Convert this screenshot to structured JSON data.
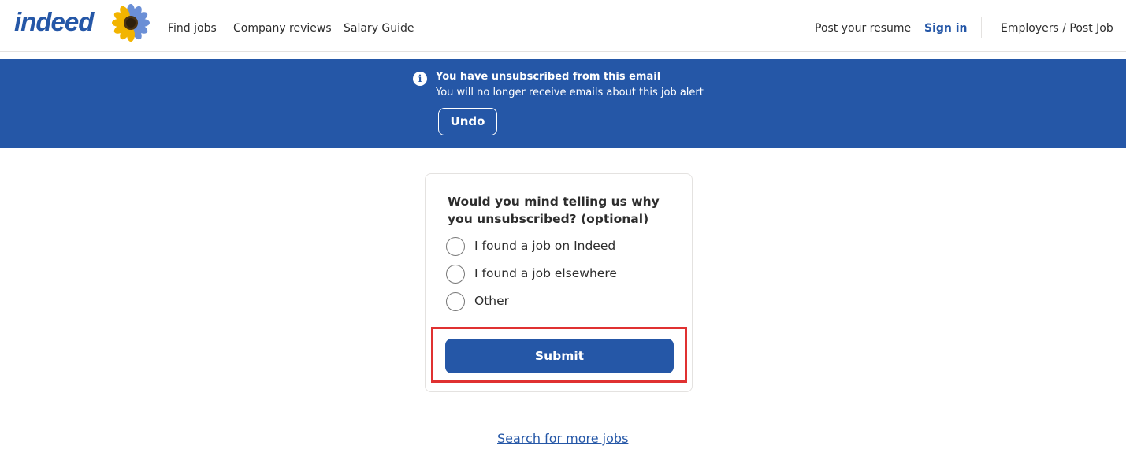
{
  "header": {
    "logo": "indeed",
    "nav": {
      "find_jobs": "Find jobs",
      "company_reviews": "Company reviews",
      "salary_guide": "Salary Guide",
      "post_resume": "Post your resume",
      "sign_in": "Sign in",
      "employers": "Employers / Post Job"
    }
  },
  "banner": {
    "title": "You have unsubscribed from this email",
    "subtitle": "You will no longer receive emails about this job alert",
    "undo_label": "Undo",
    "icon": "info-icon",
    "background": "#2557a7"
  },
  "survey": {
    "question": "Would you mind telling us why you unsubscribed? (optional)",
    "options": [
      {
        "label": "I found a job on Indeed",
        "selected": false
      },
      {
        "label": "I found a job elsewhere",
        "selected": false
      },
      {
        "label": "Other",
        "selected": false
      }
    ],
    "submit_label": "Submit",
    "highlight_color": "#e03131"
  },
  "footer": {
    "more_jobs_link": "Search for more jobs"
  },
  "colors": {
    "brand": "#2557a7",
    "text": "#2d2d2d"
  }
}
